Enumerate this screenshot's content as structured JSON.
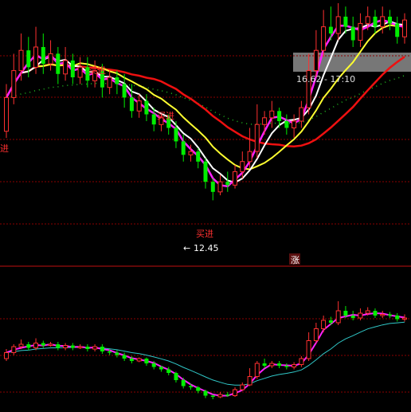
{
  "colors": {
    "background": "#000000",
    "up": "#ff3030",
    "down": "#00ee00",
    "cyan": "#00e5ee",
    "magenta": "#ff20ff",
    "white": "#ffffff",
    "yellow": "#ffff30",
    "red_line": "#ee1010",
    "green_dots": "#20c020",
    "grid": "#8b0000",
    "divider": "#c01010",
    "sub_flat": "#30c8c8",
    "highlight_bar": "#777777"
  },
  "annotations": {
    "buy_1": "买进",
    "buy_2": "买进",
    "buy_3": "买进",
    "low_label": "12.45",
    "crosshair_readout": "16.62 - 17:10",
    "rise_badge": "涨"
  },
  "chart_data": [
    {
      "type": "candlestick",
      "panel": "main",
      "title": "",
      "xlabel": "",
      "ylabel": "",
      "ylim": [
        11.3,
        18.3
      ],
      "grid": true,
      "low_marker": 12.45,
      "candles": [
        [
          14.5,
          15.5,
          14.3,
          15.9
        ],
        [
          15.5,
          16.3,
          15.3,
          16.8
        ],
        [
          16.3,
          16.9,
          16.0,
          17.4
        ],
        [
          16.9,
          16.4,
          16.1,
          17.3
        ],
        [
          16.4,
          17.0,
          16.2,
          17.6
        ],
        [
          17.0,
          16.5,
          16.2,
          17.4
        ],
        [
          16.5,
          16.8,
          16.3,
          17.2
        ],
        [
          16.8,
          16.2,
          15.9,
          17.0
        ],
        [
          16.2,
          16.6,
          16.0,
          17.0
        ],
        [
          16.6,
          16.1,
          15.9,
          16.8
        ],
        [
          16.1,
          16.4,
          15.9,
          16.7
        ],
        [
          16.4,
          16.0,
          15.8,
          16.7
        ],
        [
          16.0,
          16.3,
          15.8,
          16.6
        ],
        [
          16.3,
          15.8,
          15.5,
          16.5
        ],
        [
          15.8,
          16.1,
          15.6,
          16.3
        ],
        [
          16.1,
          15.9,
          15.6,
          16.3
        ],
        [
          15.9,
          15.5,
          15.2,
          16.2
        ],
        [
          15.5,
          15.1,
          14.9,
          15.9
        ],
        [
          15.1,
          15.4,
          14.9,
          15.6
        ],
        [
          15.4,
          15.0,
          14.8,
          15.6
        ],
        [
          15.0,
          14.7,
          14.5,
          15.2
        ],
        [
          14.7,
          14.9,
          14.5,
          15.0
        ],
        [
          14.9,
          14.6,
          14.4,
          15.0
        ],
        [
          14.6,
          14.2,
          14.0,
          14.8
        ],
        [
          14.2,
          13.8,
          13.6,
          14.4
        ],
        [
          13.8,
          13.9,
          13.6,
          14.1
        ],
        [
          13.9,
          13.6,
          13.4,
          14.0
        ],
        [
          13.6,
          13.0,
          12.8,
          13.7
        ],
        [
          13.0,
          12.7,
          12.45,
          13.1
        ],
        [
          12.7,
          13.0,
          12.6,
          13.2
        ],
        [
          13.0,
          12.9,
          12.7,
          13.3
        ],
        [
          12.9,
          13.3,
          12.8,
          13.5
        ],
        [
          13.3,
          13.6,
          13.1,
          13.9
        ],
        [
          13.6,
          13.9,
          13.4,
          14.6
        ],
        [
          13.9,
          14.7,
          13.7,
          15.3
        ],
        [
          14.7,
          14.9,
          14.4,
          15.1
        ],
        [
          14.9,
          15.1,
          14.6,
          15.4
        ],
        [
          15.1,
          14.8,
          14.6,
          15.2
        ],
        [
          14.8,
          14.6,
          14.4,
          15.0
        ],
        [
          14.6,
          14.8,
          14.3,
          15.0
        ],
        [
          14.8,
          15.2,
          14.6,
          15.4
        ],
        [
          15.2,
          16.3,
          15.0,
          16.8
        ],
        [
          16.3,
          16.9,
          16.1,
          17.5
        ],
        [
          16.9,
          17.6,
          16.7,
          18.1
        ],
        [
          17.6,
          17.4,
          17.2,
          18.2
        ],
        [
          17.4,
          17.9,
          17.2,
          18.3
        ],
        [
          17.9,
          17.6,
          17.4,
          18.2
        ],
        [
          17.6,
          17.2,
          17.0,
          17.9
        ],
        [
          17.2,
          17.7,
          17.0,
          18.0
        ],
        [
          17.7,
          17.9,
          17.5,
          18.2
        ],
        [
          17.9,
          17.6,
          17.4,
          18.1
        ],
        [
          17.6,
          17.9,
          17.4,
          18.2
        ],
        [
          17.9,
          17.7,
          17.5,
          18.1
        ],
        [
          17.7,
          17.3,
          17.1,
          17.9
        ],
        [
          17.3,
          17.8,
          17.1,
          18.0
        ]
      ]
    },
    {
      "type": "candlestick",
      "panel": "sub",
      "title": "",
      "xlabel": "",
      "ylabel": "",
      "ylim": [
        0,
        100
      ],
      "candles": [
        [
          40,
          45,
          38,
          48
        ],
        [
          45,
          50,
          43,
          52
        ],
        [
          50,
          52,
          48,
          56
        ],
        [
          52,
          49,
          47,
          54
        ],
        [
          49,
          53,
          47,
          57
        ],
        [
          53,
          51,
          49,
          55
        ],
        [
          51,
          52,
          50,
          54
        ],
        [
          52,
          49,
          47,
          54
        ],
        [
          49,
          51,
          47,
          53
        ],
        [
          51,
          49,
          47,
          53
        ],
        [
          49,
          50,
          48,
          52
        ],
        [
          50,
          48,
          46,
          52
        ],
        [
          48,
          50,
          46,
          52
        ],
        [
          50,
          46,
          44,
          52
        ],
        [
          46,
          45,
          43,
          48
        ],
        [
          45,
          43,
          41,
          47
        ],
        [
          43,
          40,
          38,
          45
        ],
        [
          40,
          38,
          36,
          42
        ],
        [
          38,
          40,
          37,
          41
        ],
        [
          40,
          36,
          34,
          41
        ],
        [
          36,
          33,
          31,
          38
        ],
        [
          33,
          31,
          29,
          34
        ],
        [
          31,
          28,
          26,
          33
        ],
        [
          28,
          22,
          20,
          29
        ],
        [
          22,
          17,
          15,
          24
        ],
        [
          17,
          16,
          14,
          19
        ],
        [
          16,
          13,
          11,
          17
        ],
        [
          13,
          9,
          7,
          14
        ],
        [
          9,
          8,
          6,
          10
        ],
        [
          8,
          10,
          7,
          12
        ],
        [
          10,
          9,
          8,
          12
        ],
        [
          9,
          14,
          8,
          16
        ],
        [
          14,
          18,
          13,
          20
        ],
        [
          18,
          25,
          17,
          32
        ],
        [
          25,
          36,
          23,
          38
        ],
        [
          36,
          34,
          32,
          40
        ],
        [
          34,
          36,
          32,
          38
        ],
        [
          36,
          34,
          32,
          38
        ],
        [
          34,
          33,
          31,
          36
        ],
        [
          33,
          35,
          31,
          37
        ],
        [
          35,
          40,
          33,
          42
        ],
        [
          40,
          55,
          38,
          62
        ],
        [
          55,
          65,
          53,
          70
        ],
        [
          65,
          72,
          62,
          76
        ],
        [
          72,
          70,
          68,
          75
        ],
        [
          70,
          80,
          68,
          88
        ],
        [
          80,
          76,
          74,
          84
        ],
        [
          76,
          74,
          72,
          80
        ],
        [
          74,
          78,
          72,
          82
        ],
        [
          78,
          80,
          76,
          83
        ],
        [
          80,
          76,
          74,
          82
        ],
        [
          76,
          77,
          74,
          80
        ],
        [
          77,
          76,
          74,
          79
        ],
        [
          76,
          73,
          71,
          78
        ],
        [
          73,
          74,
          71,
          77
        ]
      ]
    }
  ]
}
